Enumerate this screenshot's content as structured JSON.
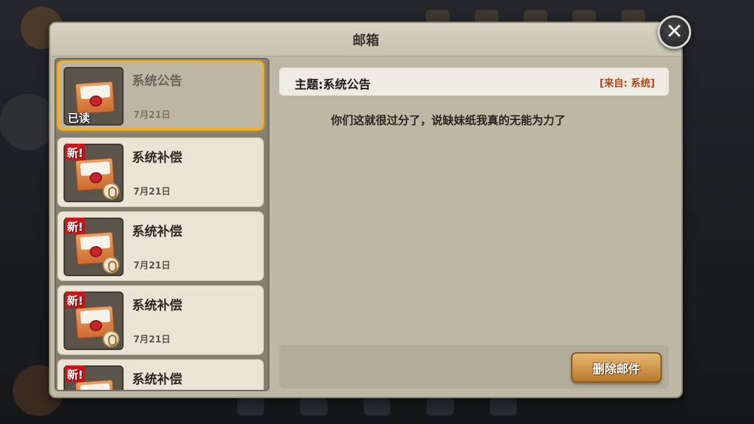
{
  "window": {
    "title": "邮箱",
    "close_label": "✕"
  },
  "mail_list": {
    "items": [
      {
        "subject": "系统公告",
        "date": "7月21日",
        "status_label": "已读",
        "has_attachment": false,
        "selected": true
      },
      {
        "subject": "系统补偿",
        "date": "7月21日",
        "status_label": "新!",
        "has_attachment": true,
        "selected": false
      },
      {
        "subject": "系统补偿",
        "date": "7月21日",
        "status_label": "新!",
        "has_attachment": true,
        "selected": false
      },
      {
        "subject": "系统补偿",
        "date": "7月21日",
        "status_label": "新!",
        "has_attachment": true,
        "selected": false
      },
      {
        "subject": "系统补偿",
        "date": "",
        "status_label": "新!",
        "has_attachment": false,
        "selected": false
      }
    ]
  },
  "detail": {
    "subject": "主题:系统公告",
    "from": "[来自:  系统]",
    "body": "你们这就很过分了，说缺妹纸我真的无能为力了",
    "delete_label": "删除邮件"
  },
  "colors": {
    "selected_border": "#f3b21c",
    "new_badge": "#c8161d",
    "from_text": "#b0461e"
  },
  "icons": {
    "mail": "envelope-icon",
    "attachment": "paperclip-icon",
    "close": "close-icon"
  }
}
